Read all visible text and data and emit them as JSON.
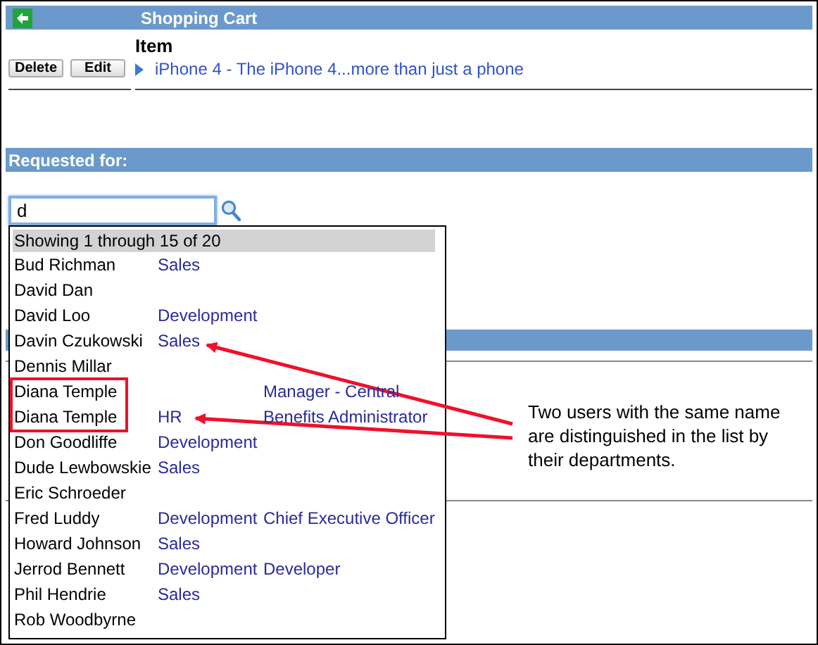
{
  "header": {
    "title": "Shopping Cart"
  },
  "cart": {
    "column": "Item",
    "buttons": [
      "Delete",
      "Edit"
    ],
    "item": "iPhone 4 - The iPhone 4...more than just a phone"
  },
  "requested_for": {
    "title": "Requested for:",
    "search": {
      "value": "d"
    }
  },
  "dropdown": {
    "status": "Showing 1 through 15 of 20",
    "rows": [
      {
        "name": "Bud Richman",
        "department": "Sales",
        "highlighted": false
      },
      {
        "name": "David Dan",
        "highlighted": false
      },
      {
        "name": "David Loo",
        "department": "Development",
        "highlighted": false
      },
      {
        "name": "Davin Czukowski",
        "department": "Sales",
        "highlighted": false
      },
      {
        "name": "Dennis Millar",
        "highlighted": false
      },
      {
        "name": "Diana Temple",
        "title": "Manager - Central",
        "highlighted": true
      },
      {
        "name": "Diana Temple",
        "department": "HR",
        "title": "Benefits Administrator",
        "highlighted": true
      },
      {
        "name": "Don Goodliffe",
        "department": "Development",
        "highlighted": false
      },
      {
        "name": "Dude Lewbowskie",
        "department": "Sales",
        "highlighted": false
      },
      {
        "name": "Eric Schroeder",
        "highlighted": false
      },
      {
        "name": "Fred Luddy",
        "department": "Development",
        "title": "Chief Executive Officer",
        "highlighted": false
      },
      {
        "name": "Howard Johnson",
        "department": "Sales",
        "highlighted": false
      },
      {
        "name": "Jerrod Bennett",
        "department": "Development",
        "title": "Developer",
        "highlighted": false
      },
      {
        "name": "Phil Hendrie",
        "department": "Sales",
        "highlighted": false
      },
      {
        "name": "Rob Woodbyrne",
        "highlighted": false
      }
    ]
  },
  "annotation": {
    "text": "Two users with the same name are distinguished in the list by their departments."
  }
}
